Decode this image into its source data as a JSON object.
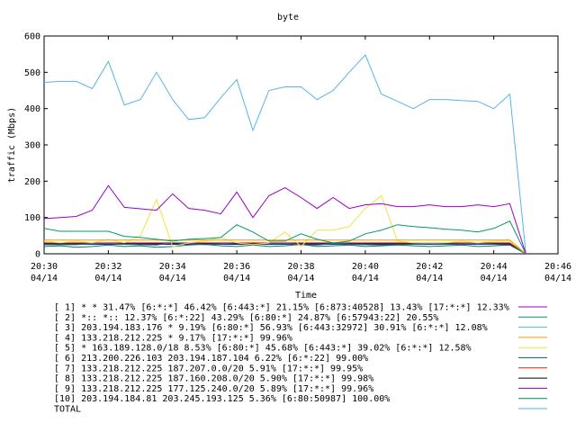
{
  "chart_data": {
    "type": "line",
    "title": "byte",
    "xlabel": "Time",
    "ylabel": "traffic (Mbps)",
    "ylim": [
      0,
      600
    ],
    "xlim": [
      "20:30",
      "20:46"
    ],
    "yticks": [
      0,
      100,
      200,
      300,
      400,
      500,
      600
    ],
    "xticks": [
      {
        "t": "20:30",
        "d": "04/14"
      },
      {
        "t": "20:32",
        "d": "04/14"
      },
      {
        "t": "20:34",
        "d": "04/14"
      },
      {
        "t": "20:36",
        "d": "04/14"
      },
      {
        "t": "20:38",
        "d": "04/14"
      },
      {
        "t": "20:40",
        "d": "04/14"
      },
      {
        "t": "20:42",
        "d": "04/14"
      },
      {
        "t": "20:44",
        "d": "04/14"
      },
      {
        "t": "20:46",
        "d": "04/14"
      }
    ],
    "grid": false,
    "legend_position": "bottom",
    "x": [
      "20:30:00",
      "20:30:30",
      "20:31:00",
      "20:31:30",
      "20:32:00",
      "20:32:30",
      "20:33:00",
      "20:33:30",
      "20:34:00",
      "20:34:30",
      "20:35:00",
      "20:35:30",
      "20:36:00",
      "20:36:30",
      "20:37:00",
      "20:37:30",
      "20:38:00",
      "20:38:30",
      "20:39:00",
      "20:39:30",
      "20:40:00",
      "20:40:30",
      "20:41:00",
      "20:41:30",
      "20:42:00",
      "20:42:30",
      "20:43:00",
      "20:43:30",
      "20:44:00",
      "20:44:30",
      "20:45:00"
    ],
    "series": [
      {
        "name": "[ 1] * * 31.47%  [6:*:*] 46.42% [6:443:*] 21.15% [6:873:40528] 13.43% [17:*:*] 12.33%",
        "color": "#9900cc",
        "values": [
          97,
          100,
          103,
          120,
          188,
          128,
          124,
          120,
          165,
          125,
          120,
          110,
          170,
          100,
          160,
          182,
          155,
          125,
          155,
          125,
          135,
          138,
          130,
          130,
          135,
          130,
          130,
          135,
          130,
          138,
          0
        ]
      },
      {
        "name": "[ 2] *:: *:: 12.37%  [6:*:22] 43.29% [6:80:*] 24.87% [6:57943:22] 20.55%",
        "color": "#009966",
        "values": [
          70,
          62,
          62,
          62,
          62,
          48,
          45,
          40,
          35,
          40,
          42,
          45,
          80,
          60,
          35,
          35,
          55,
          40,
          30,
          35,
          55,
          65,
          80,
          75,
          72,
          68,
          65,
          60,
          70,
          90,
          0
        ]
      },
      {
        "name": "[ 3] 203.194.183.176 * 9.19%  [6:80:*] 56.93% [6:443:32972] 30.91% [6:*:*] 12.08%",
        "color": "#56b4e9",
        "values": [
          472,
          475,
          475,
          455,
          530,
          410,
          425,
          500,
          425,
          370,
          375,
          430,
          480,
          340,
          450,
          460,
          460,
          425,
          450,
          500,
          548,
          440,
          420,
          400,
          425,
          425,
          422,
          420,
          400,
          440,
          0
        ]
      },
      {
        "name": "[ 4] 133.218.212.225 * 9.17%  [17:*:*] 99.96%",
        "color": "#e69f00",
        "values": [
          38,
          38,
          38,
          38,
          38,
          38,
          38,
          38,
          38,
          38,
          38,
          38,
          38,
          38,
          38,
          38,
          38,
          38,
          38,
          38,
          38,
          38,
          38,
          38,
          38,
          38,
          38,
          38,
          38,
          38,
          0
        ]
      },
      {
        "name": "[ 5] * 163.189.128.0/18 8.53%  [6:80:*] 45.68% [6:443:*] 39.02% [6:*:*] 12.58%",
        "color": "#f0e442",
        "values": [
          35,
          30,
          35,
          30,
          40,
          30,
          50,
          150,
          20,
          30,
          35,
          45,
          30,
          25,
          30,
          60,
          20,
          65,
          65,
          75,
          125,
          160,
          35,
          30,
          30,
          30,
          35,
          30,
          35,
          35,
          0
        ]
      },
      {
        "name": "[ 6] 213.200.226.103 203.194.187.104 6.22%  [6:*:22] 99.00%",
        "color": "#0072b2",
        "values": [
          25,
          25,
          25,
          28,
          28,
          26,
          25,
          24,
          30,
          28,
          25,
          27,
          30,
          26,
          28,
          28,
          25,
          24,
          28,
          26,
          25,
          24,
          25,
          26,
          28,
          26,
          27,
          28,
          26,
          24,
          0
        ]
      },
      {
        "name": "[ 7] 133.218.212.225 187.207.0.0/20 5.91%  [17:*:*] 99.95%",
        "color": "#e51e10",
        "values": [
          30,
          30,
          30,
          30,
          30,
          30,
          30,
          30,
          30,
          30,
          30,
          30,
          30,
          30,
          30,
          30,
          30,
          30,
          30,
          30,
          30,
          30,
          30,
          30,
          30,
          30,
          30,
          30,
          30,
          30,
          0
        ]
      },
      {
        "name": "[ 8] 133.218.212.225 187.160.208.0/20 5.90%  [17:*:*] 99.98%",
        "color": "#000000",
        "values": [
          28,
          28,
          28,
          28,
          28,
          28,
          28,
          28,
          28,
          28,
          28,
          28,
          28,
          28,
          28,
          28,
          28,
          28,
          28,
          28,
          28,
          28,
          28,
          28,
          28,
          28,
          28,
          28,
          28,
          28,
          0
        ]
      },
      {
        "name": "[ 9] 133.218.212.225 177.125.240.0/20 5.89%  [17:*:*] 99.96%",
        "color": "#7b00a8",
        "values": [
          26,
          26,
          26,
          26,
          26,
          26,
          26,
          26,
          26,
          26,
          26,
          26,
          26,
          26,
          26,
          26,
          26,
          26,
          26,
          26,
          26,
          26,
          26,
          26,
          26,
          26,
          26,
          26,
          26,
          26,
          0
        ]
      },
      {
        "name": "[10] 203.194.184.81 203.245.193.125 5.36%  [6:80:50987] 100.00%",
        "color": "#00805c",
        "values": [
          20,
          22,
          18,
          20,
          24,
          20,
          22,
          18,
          20,
          24,
          26,
          22,
          20,
          24,
          20,
          22,
          26,
          20,
          22,
          24,
          20,
          22,
          24,
          22,
          20,
          22,
          24,
          20,
          22,
          24,
          0
        ]
      },
      {
        "name": "TOTAL",
        "color": "#4fb0e8",
        "values": []
      }
    ]
  }
}
